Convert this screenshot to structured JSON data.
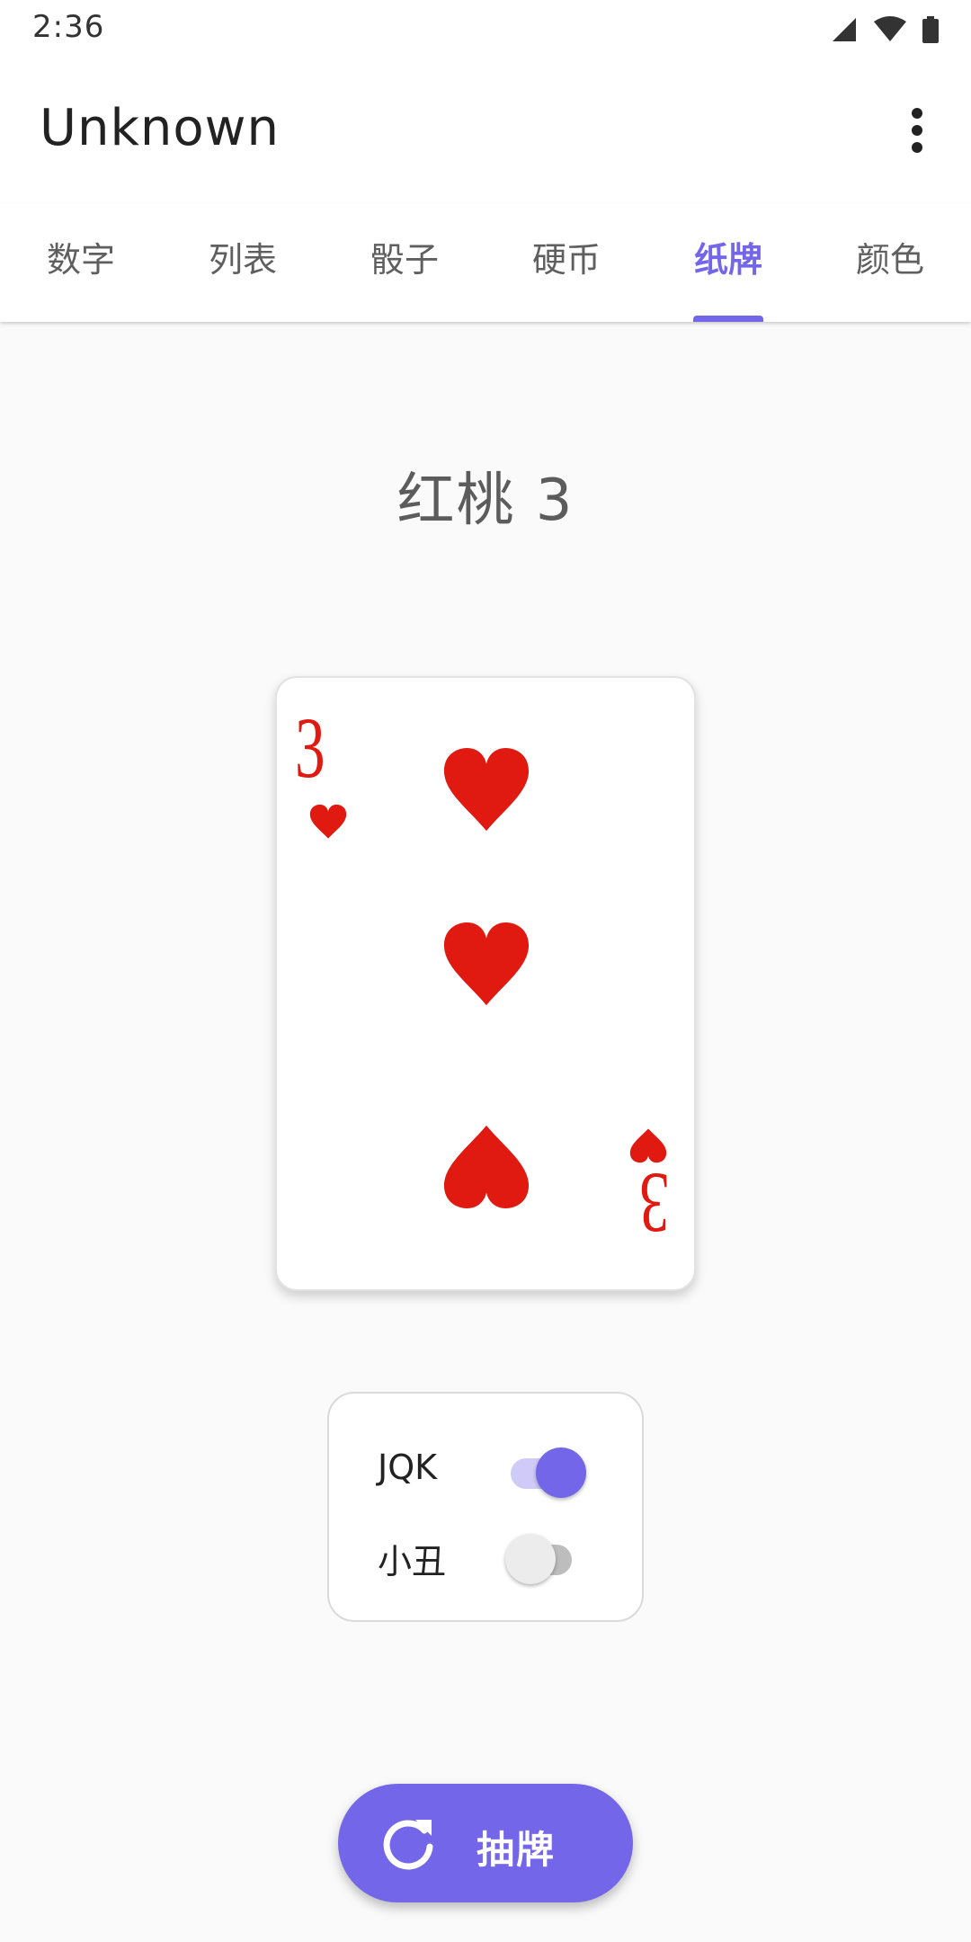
{
  "status_bar": {
    "time": "2:36"
  },
  "app_bar": {
    "title": "Unknown",
    "overflow_icon": "more-vert-icon"
  },
  "tabs": [
    {
      "label": "数字",
      "active": false
    },
    {
      "label": "列表",
      "active": false
    },
    {
      "label": "骰子",
      "active": false
    },
    {
      "label": "硬币",
      "active": false
    },
    {
      "label": "纸牌",
      "active": true
    },
    {
      "label": "颜色",
      "active": false
    }
  ],
  "result": {
    "title": "红桃 3"
  },
  "card": {
    "rank": "3",
    "suit": "heart",
    "suit_color": "#e01a10"
  },
  "options": {
    "jqk": {
      "label": "JQK",
      "checked": true
    },
    "joker": {
      "label": "小丑",
      "checked": false
    }
  },
  "fab": {
    "label": "抽牌",
    "icon": "refresh-icon"
  },
  "colors": {
    "accent": "#7366e8",
    "card_red": "#e01a10"
  }
}
